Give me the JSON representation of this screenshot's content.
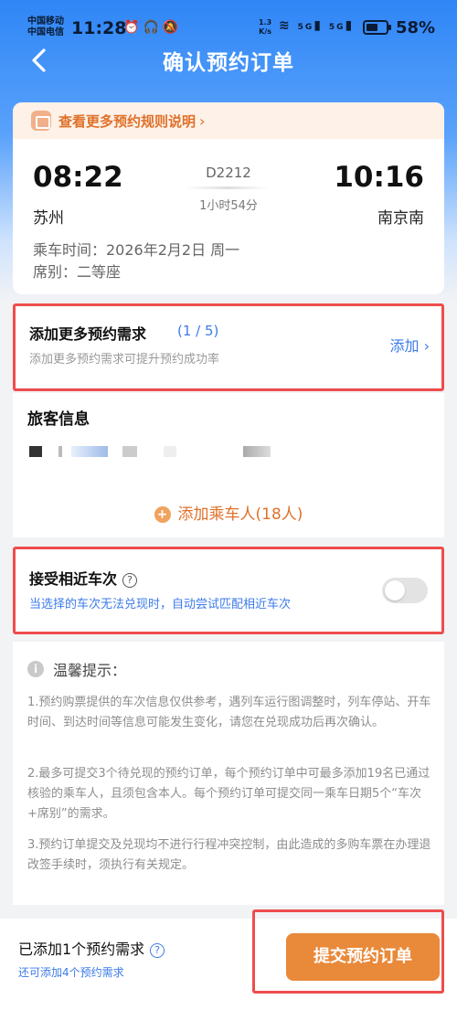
{
  "status_bar": {
    "carrier_1": "中国移动",
    "carrier_2": "中国电信",
    "time": "11:28",
    "net_speed_top": "1.3",
    "net_speed_bottom": "K/s",
    "signal_1": "5G",
    "signal_2": "5G",
    "battery": "58%",
    "battery_level": 0.58
  },
  "header": {
    "title": "确认预约订单",
    "back_icon": "chevron-left-icon"
  },
  "rules_banner": {
    "text": "查看更多预约规则说明",
    "chevron": "›"
  },
  "trip": {
    "departure_time": "08:22",
    "departure_station": "苏州",
    "arrival_time": "10:16",
    "arrival_station": "南京南",
    "train_number": "D2212",
    "duration": "1小时54分",
    "ride_date": "乘车时间：2026年2月2日 周一",
    "seat": "席别：二等座"
  },
  "requirements": {
    "title": "添加更多预约需求",
    "count": "(1 / 5)",
    "subtitle": "添加更多预约需求可提升预约成功率",
    "add_label": "添加 ›"
  },
  "passengers": {
    "title": "旅客信息",
    "add_label": "添加乘车人(18人)",
    "add_icon": "+"
  },
  "nearby_trains": {
    "title": "接受相近车次",
    "help_icon": "?",
    "subtitle": "当选择的车次无法兑现时，自动尝试匹配相近车次",
    "enabled": false
  },
  "tips": {
    "icon": "i",
    "title": "温馨提示：",
    "items": [
      "1.预约购票提供的车次信息仅供参考，遇列车运行图调整时，列车停站、开车时间、到达时间等信息可能发生变化，请您在兑现成功后再次确认。",
      "2.最多可提交3个待兑现的预约订单，每个预约订单中可最多添加19名已通过核验的乘车人，且须包含本人。每个预约订单可提交同一乘车日期5个“车次+席别”的需求。",
      "3.预约订单提交及兑现均不进行行程冲突控制，由此造成的多购车票在办理退改签手续时，须执行有关规定。"
    ]
  },
  "bottom_bar": {
    "added_text": "已添加1个预约需求",
    "help_icon": "?",
    "added_sub": "还可添加4个预约需求",
    "submit_label": "提交预约订单"
  },
  "colors": {
    "header_blue": "#2f86f6",
    "accent_blue": "#3d7be9",
    "accent_orange": "#e9893a",
    "highlight_red": "#ee4d4d"
  }
}
